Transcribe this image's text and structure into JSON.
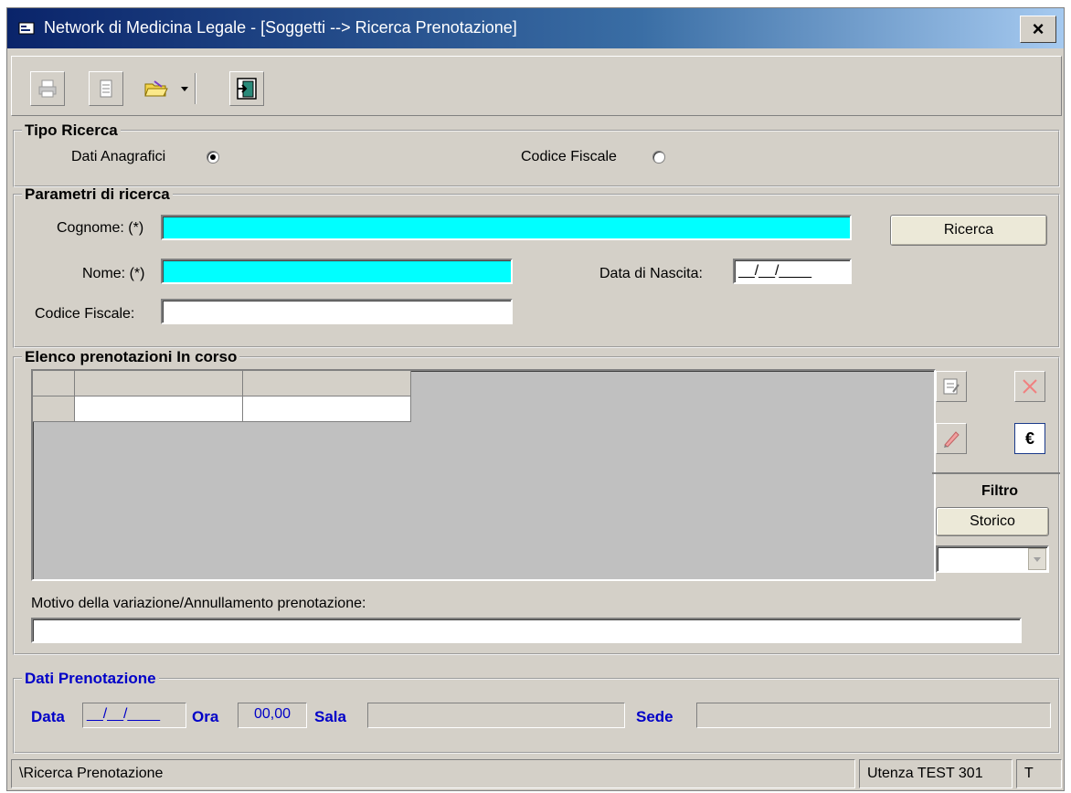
{
  "window": {
    "title": "Network di Medicina Legale - [Soggetti --> Ricerca Prenotazione]",
    "close_label": "×"
  },
  "toolbar": {
    "buttons": [
      "print-icon",
      "document-icon",
      "open-folder-icon",
      "exit-door-icon"
    ]
  },
  "tipo_ricerca": {
    "legend": "Tipo Ricerca",
    "option_anagrafici": "Dati Anagrafici",
    "option_codice_fiscale": "Codice Fiscale",
    "selected": "Dati Anagrafici"
  },
  "parametri": {
    "legend": "Parametri di ricerca",
    "cognome_label": "Cognome: (*)",
    "cognome_value": "",
    "nome_label": "Nome: (*)",
    "nome_value": "",
    "codice_fiscale_label": "Codice Fiscale:",
    "codice_fiscale_value": "",
    "data_nascita_label": "Data di Nascita:",
    "data_nascita_value": "__/__/____",
    "ricerca_button": "Ricerca"
  },
  "elenco": {
    "legend": "Elenco prenotazioni In corso",
    "filtro_label": "Filtro",
    "storico_button": "Storico",
    "euro_label": "€",
    "motivo_label": "Motivo della variazione/Annullamento prenotazione:",
    "motivo_value": ""
  },
  "dati_prenotazione": {
    "legend": "Dati Prenotazione",
    "data_label": "Data",
    "data_value": "__/__/____",
    "ora_label": "Ora",
    "ora_value": "00,00",
    "sala_label": "Sala",
    "sala_value": "",
    "sede_label": "Sede",
    "sede_value": ""
  },
  "statusbar": {
    "left": "\\Ricerca Prenotazione",
    "user": "Utenza TEST 301",
    "mode": "T"
  },
  "colors": {
    "title_gradient_start": "#0a246a",
    "required_field": "#00ffff",
    "accent_blue": "#0000c8",
    "panel": "#d4d0c8"
  }
}
